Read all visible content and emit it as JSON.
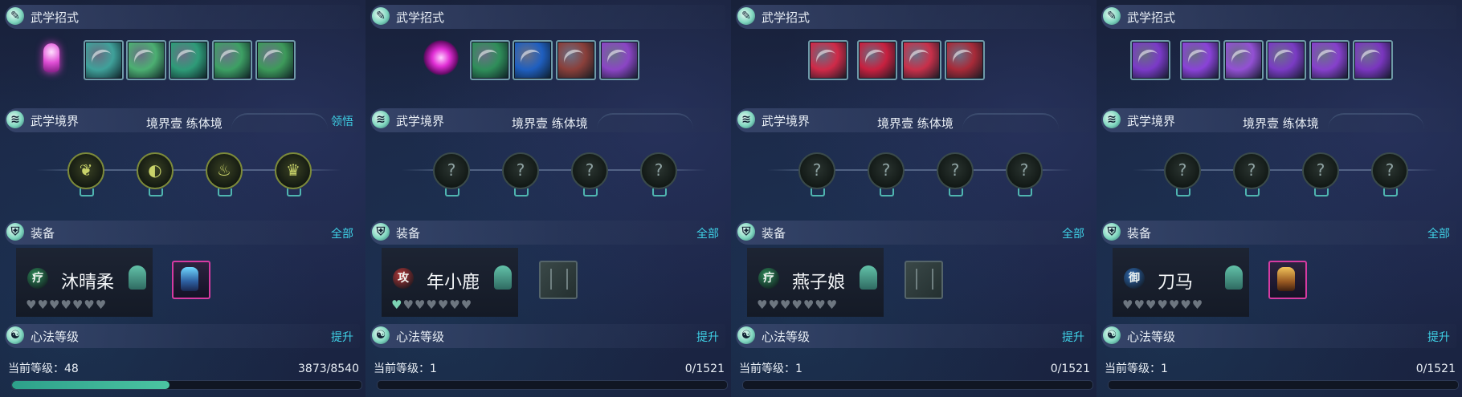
{
  "sections": {
    "skills_title": "武学招式",
    "realm_title": "武学境界",
    "equip_title": "装备",
    "equip_link": "全部",
    "method_title": "心法等级",
    "method_link": "提升",
    "level_prefix": "当前等级："
  },
  "realm_note": "境界壹  练体境",
  "colors": {
    "accent_link": "#3fd1e6",
    "progress": "#3fb499"
  },
  "panels": [
    {
      "realm_link": "领悟",
      "skills": [
        {
          "name": "character-skill-icon",
          "tint": "#b93fb0"
        },
        {
          "name": "skill-icon",
          "tint": "#3fa19a"
        },
        {
          "name": "skill-icon",
          "tint": "#4caf72"
        },
        {
          "name": "skill-icon",
          "tint": "#2e9b78"
        },
        {
          "name": "skill-icon",
          "tint": "#3da064"
        },
        {
          "name": "skill-icon",
          "tint": "#3d9a5a"
        }
      ],
      "nodes_lit": true,
      "character": {
        "class_icon": "疗",
        "class_color": "#2f8e5a",
        "name": "沐晴柔",
        "hearts_filled": 0,
        "hearts_total": 7
      },
      "equip_state": "filled",
      "level": "48",
      "exp": "3873/8540",
      "progress": 0.45
    },
    {
      "realm_link": "",
      "skills": [
        {
          "name": "orb-skill-icon",
          "tint": "#c824c4"
        },
        {
          "name": "skill-icon",
          "tint": "#2f8e5a"
        },
        {
          "name": "skill-icon",
          "tint": "#1f5fc0"
        },
        {
          "name": "skill-icon",
          "tint": "#8a3f3a"
        },
        {
          "name": "skill-icon",
          "tint": "#8b45c5"
        }
      ],
      "nodes_lit": false,
      "character": {
        "class_icon": "攻",
        "class_color": "#b83838",
        "name": "年小鹿",
        "hearts_filled": 1,
        "hearts_total": 7
      },
      "equip_state": "empty",
      "level": "1",
      "exp": "0/1521",
      "progress": 0
    },
    {
      "realm_link": "",
      "skills": [
        {
          "name": "skill-icon",
          "tint": "#d02a48"
        },
        {
          "name": "skill-icon",
          "tint": "#c8203f"
        },
        {
          "name": "skill-icon",
          "tint": "#c8304a"
        },
        {
          "name": "skill-icon",
          "tint": "#a82a38"
        }
      ],
      "nodes_lit": false,
      "character": {
        "class_icon": "疗",
        "class_color": "#2f8e5a",
        "name": "燕子娘",
        "hearts_filled": 0,
        "hearts_total": 7
      },
      "equip_state": "empty",
      "level": "1",
      "exp": "0/1521",
      "progress": 0
    },
    {
      "realm_link": "",
      "skills": [
        {
          "name": "skill-icon",
          "tint": "#7b3ac8"
        },
        {
          "name": "skill-icon",
          "tint": "#8a42d8"
        },
        {
          "name": "skill-icon",
          "tint": "#9350d4"
        },
        {
          "name": "skill-icon",
          "tint": "#7a3bc4"
        },
        {
          "name": "skill-icon",
          "tint": "#8640cc"
        },
        {
          "name": "skill-icon",
          "tint": "#7a36bf"
        }
      ],
      "nodes_lit": false,
      "character": {
        "class_icon": "御",
        "class_color": "#2f6cb5",
        "name": "刀马",
        "hearts_filled": 0,
        "hearts_total": 7
      },
      "equip_state": "filled-gold",
      "level": "1",
      "exp": "0/1521",
      "progress": 0
    }
  ]
}
